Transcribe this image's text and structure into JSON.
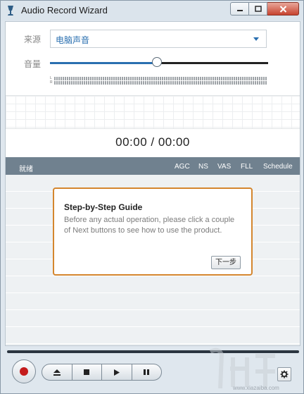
{
  "window": {
    "title": "Audio Record Wizard",
    "icons": {
      "app": "microphone-icon",
      "minimize": "minimize-icon",
      "maximize": "maximize-icon",
      "close": "close-icon"
    }
  },
  "source": {
    "label": "来源",
    "selected": "电脑声音"
  },
  "volume": {
    "label": "音量",
    "level": 0.5
  },
  "meters": {
    "left_tag": "L",
    "right_tag": "R"
  },
  "timer": {
    "text": "00:00 / 00:00"
  },
  "list_header": {
    "status": "就绪",
    "agc": "AGC",
    "ns": "NS",
    "vas": "VAS",
    "fll": "FLL",
    "schedule": "Schedule"
  },
  "guide": {
    "title": "Step-by-Step Guide",
    "body": "Before any actual operation, please click a couple of Next buttons to see how to use the product.",
    "next_label": "下一步"
  },
  "controls": {
    "icons": [
      "record-icon",
      "eject-icon",
      "stop-icon",
      "play-icon",
      "pause-icon",
      "gear-icon"
    ]
  },
  "watermark": {
    "text": "www.xiazaiba.com"
  },
  "colors": {
    "accent": "#2a6fb0",
    "header": "#70818f",
    "guide_border": "#d4862e",
    "record": "#c41b1b"
  }
}
